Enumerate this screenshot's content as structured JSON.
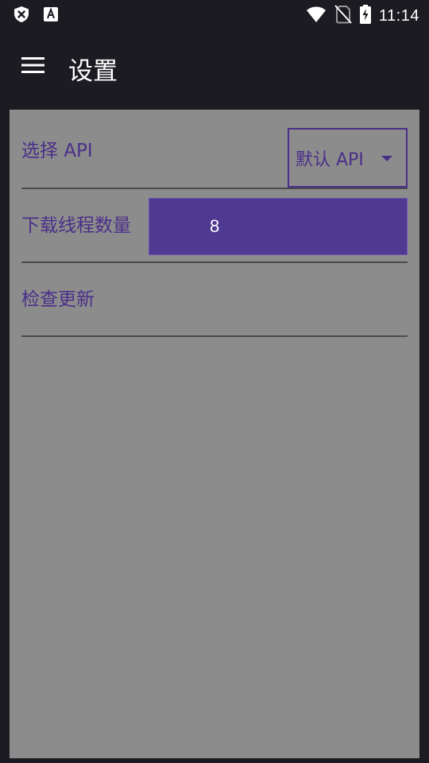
{
  "status_bar": {
    "time": "11:14",
    "left_icons": [
      "shield-x-icon",
      "app-a-icon"
    ],
    "right_icons": [
      "wifi-icon",
      "no-sim-icon",
      "battery-charging-icon"
    ]
  },
  "app_bar": {
    "title": "设置",
    "menu_icon": "hamburger-menu-icon"
  },
  "settings": {
    "select_api": {
      "label": "选择 API",
      "selected_value": "默认 API"
    },
    "download_threads": {
      "label": "下载线程数量",
      "value": "8"
    },
    "check_update": {
      "label": "检查更新"
    }
  },
  "colors": {
    "background": "#1c1b21",
    "panel": "#8c8c8c",
    "accent": "#4f3a92",
    "label": "#4a2f8a"
  }
}
